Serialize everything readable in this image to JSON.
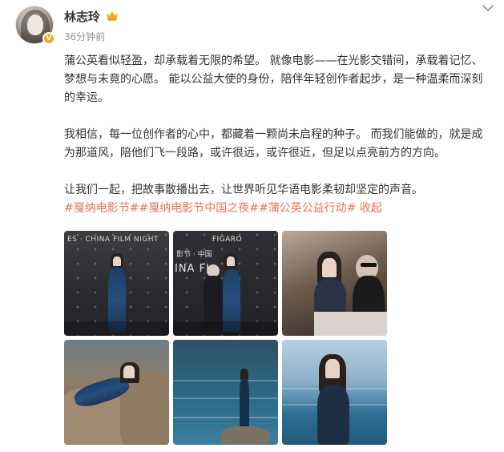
{
  "user": {
    "name": "林志玲",
    "time": "36分钟前",
    "verified_badge": "V",
    "crown_color": "#f6a623"
  },
  "post": {
    "paragraphs": [
      "蒲公英看似轻盈，却承载着无限的希望。 就像电影——在光影交错间，承载着记忆、梦想与未竟的心愿。 能以公益大使的身份，陪伴年轻创作者起步，是一种温柔而深刻的幸运。",
      "我相信，每一位创作者的心中，都藏着一颗尚未启程的种子。 而我们能做的，就是成为那道风，陪他们飞一段路，或许很远，或许很近，但足以点亮前方的方向。",
      "让我们一起，把故事散播出去，让世界听见华语电影柔韧却坚定的声音。"
    ],
    "hashtags": [
      "#戛纳电影节#",
      "#戛纳电影节中国之夜#",
      "#蒲公英公益行动#"
    ],
    "fold_label": "收起",
    "accent_color": "#eb7350"
  },
  "photos": {
    "banner_text_1": "ES · CHINA FILM NIGHT",
    "banner_text_2": "FIGARO",
    "banner_text_3": "影节 · 中国",
    "banner_text_4": "INA FI"
  },
  "icons": {
    "menu": "chevron-down-icon",
    "crown": "crown-icon"
  }
}
